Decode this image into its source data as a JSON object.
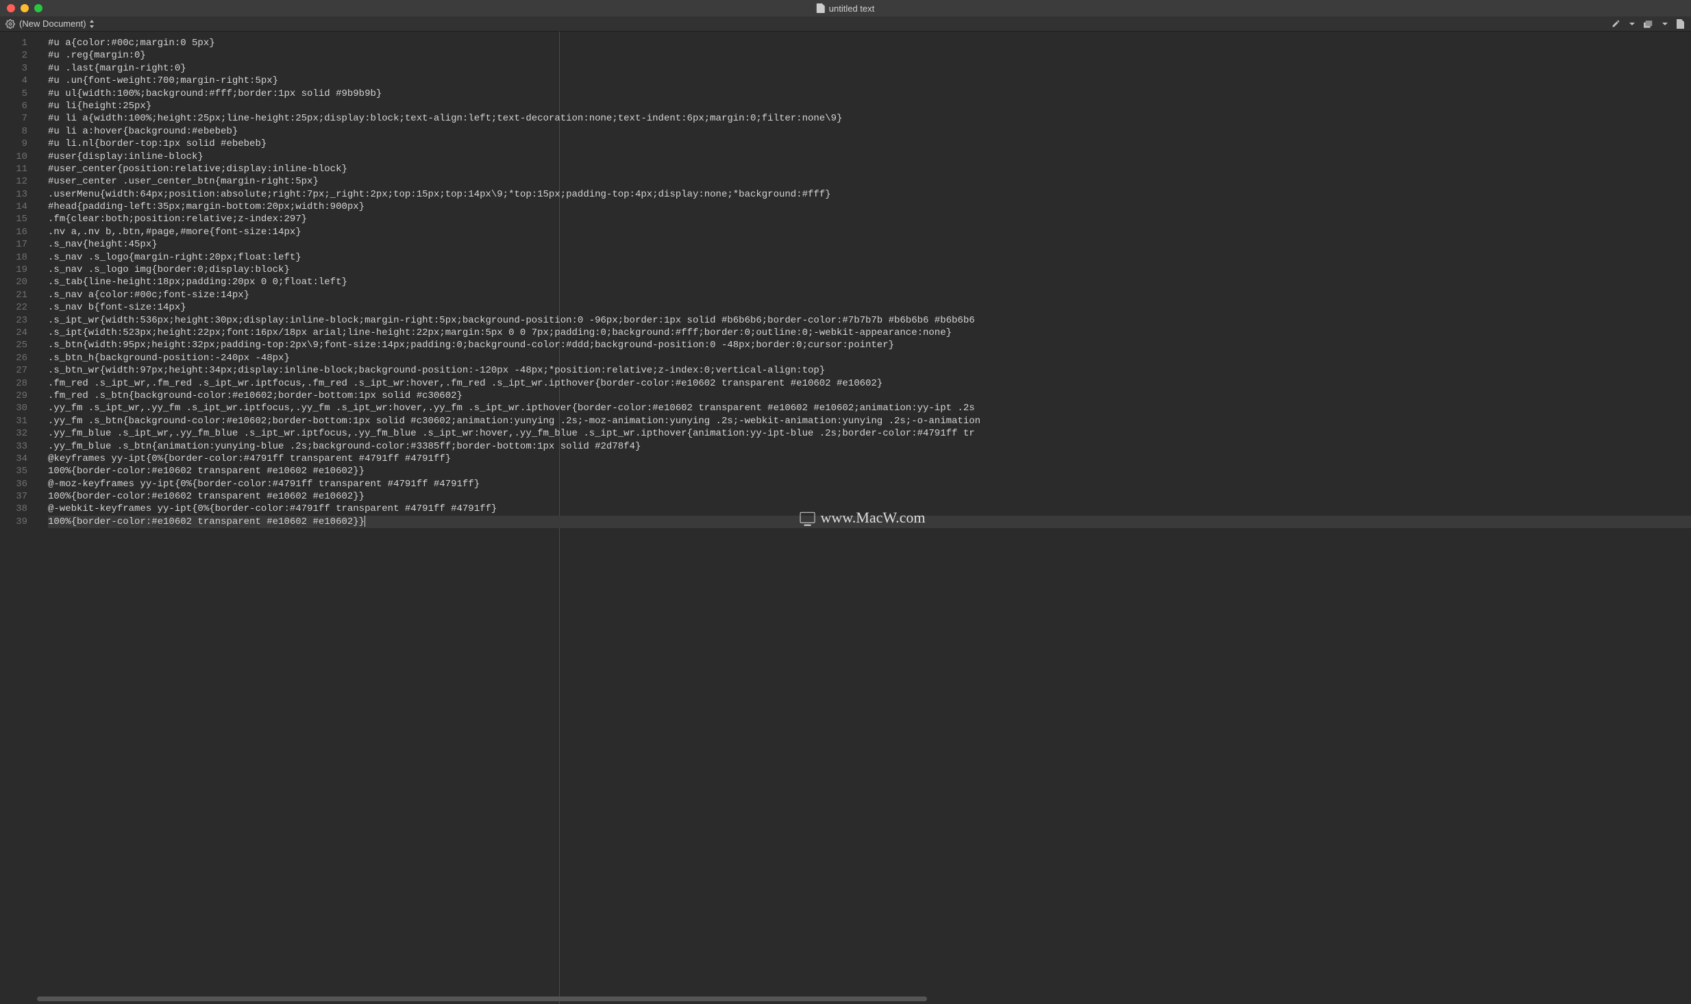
{
  "window": {
    "title": "untitled text"
  },
  "toolbar": {
    "doc_label": "(New Document)"
  },
  "watermark": {
    "text": "www.MacW.com"
  },
  "editor": {
    "guide_column": 100,
    "lines": [
      "#u a{color:#00c;margin:0 5px}",
      "#u .reg{margin:0}",
      "#u .last{margin-right:0}",
      "#u .un{font-weight:700;margin-right:5px}",
      "#u ul{width:100%;background:#fff;border:1px solid #9b9b9b}",
      "#u li{height:25px}",
      "#u li a{width:100%;height:25px;line-height:25px;display:block;text-align:left;text-decoration:none;text-indent:6px;margin:0;filter:none\\9}",
      "#u li a:hover{background:#ebebeb}",
      "#u li.nl{border-top:1px solid #ebebeb}",
      "#user{display:inline-block}",
      "#user_center{position:relative;display:inline-block}",
      "#user_center .user_center_btn{margin-right:5px}",
      ".userMenu{width:64px;position:absolute;right:7px;_right:2px;top:15px;top:14px\\9;*top:15px;padding-top:4px;display:none;*background:#fff}",
      "#head{padding-left:35px;margin-bottom:20px;width:900px}",
      ".fm{clear:both;position:relative;z-index:297}",
      ".nv a,.nv b,.btn,#page,#more{font-size:14px}",
      ".s_nav{height:45px}",
      ".s_nav .s_logo{margin-right:20px;float:left}",
      ".s_nav .s_logo img{border:0;display:block}",
      ".s_tab{line-height:18px;padding:20px 0 0;float:left}",
      ".s_nav a{color:#00c;font-size:14px}",
      ".s_nav b{font-size:14px}",
      ".s_ipt_wr{width:536px;height:30px;display:inline-block;margin-right:5px;background-position:0 -96px;border:1px solid #b6b6b6;border-color:#7b7b7b #b6b6b6 #b6b6b6",
      ".s_ipt{width:523px;height:22px;font:16px/18px arial;line-height:22px;margin:5px 0 0 7px;padding:0;background:#fff;border:0;outline:0;-webkit-appearance:none}",
      ".s_btn{width:95px;height:32px;padding-top:2px\\9;font-size:14px;padding:0;background-color:#ddd;background-position:0 -48px;border:0;cursor:pointer}",
      ".s_btn_h{background-position:-240px -48px}",
      ".s_btn_wr{width:97px;height:34px;display:inline-block;background-position:-120px -48px;*position:relative;z-index:0;vertical-align:top}",
      ".fm_red .s_ipt_wr,.fm_red .s_ipt_wr.iptfocus,.fm_red .s_ipt_wr:hover,.fm_red .s_ipt_wr.ipthover{border-color:#e10602 transparent #e10602 #e10602}",
      ".fm_red .s_btn{background-color:#e10602;border-bottom:1px solid #c30602}",
      ".yy_fm .s_ipt_wr,.yy_fm .s_ipt_wr.iptfocus,.yy_fm .s_ipt_wr:hover,.yy_fm .s_ipt_wr.ipthover{border-color:#e10602 transparent #e10602 #e10602;animation:yy-ipt .2s",
      ".yy_fm .s_btn{background-color:#e10602;border-bottom:1px solid #c30602;animation:yunying .2s;-moz-animation:yunying .2s;-webkit-animation:yunying .2s;-o-animation",
      ".yy_fm_blue .s_ipt_wr,.yy_fm_blue .s_ipt_wr.iptfocus,.yy_fm_blue .s_ipt_wr:hover,.yy_fm_blue .s_ipt_wr.ipthover{animation:yy-ipt-blue .2s;border-color:#4791ff tr",
      ".yy_fm_blue .s_btn{animation:yunying-blue .2s;background-color:#3385ff;border-bottom:1px solid #2d78f4}",
      "@keyframes yy-ipt{0%{border-color:#4791ff transparent #4791ff #4791ff}",
      "100%{border-color:#e10602 transparent #e10602 #e10602}}",
      "@-moz-keyframes yy-ipt{0%{border-color:#4791ff transparent #4791ff #4791ff}",
      "100%{border-color:#e10602 transparent #e10602 #e10602}}",
      "@-webkit-keyframes yy-ipt{0%{border-color:#4791ff transparent #4791ff #4791ff}",
      "100%{border-color:#e10602 transparent #e10602 #e10602}}"
    ],
    "current_line_index": 38
  }
}
